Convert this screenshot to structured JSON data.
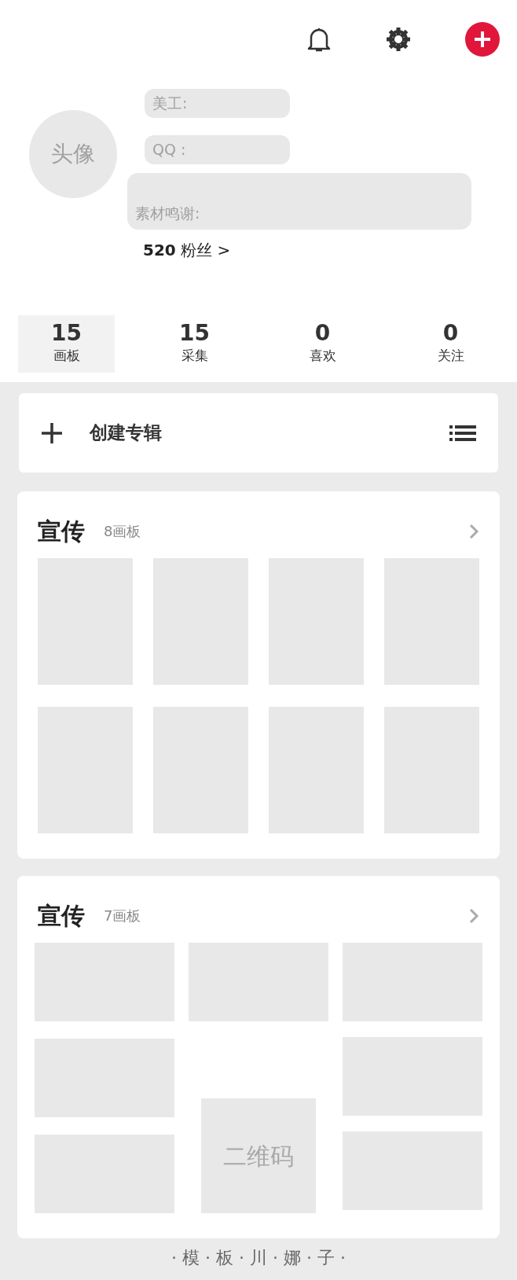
{
  "profile": {
    "avatar_label": "头像",
    "fields": [
      {
        "label": "美工:"
      },
      {
        "label": "QQ :"
      }
    ],
    "credits_label": "素材鸣谢:",
    "followers": {
      "count": "520",
      "label": "粉丝 >"
    }
  },
  "stats": [
    {
      "value": "15",
      "label": "画板",
      "selected": true
    },
    {
      "value": "15",
      "label": "采集",
      "selected": false
    },
    {
      "value": "0",
      "label": "喜欢",
      "selected": false
    },
    {
      "value": "0",
      "label": "关注",
      "selected": false
    }
  ],
  "create_album": {
    "label": "创建专辑"
  },
  "albums": [
    {
      "title": "宣传",
      "count": "8画板",
      "kind": "grid"
    },
    {
      "title": "宣传",
      "count": "7画板",
      "kind": "masonry",
      "qr_label": "二维码"
    }
  ],
  "footer": "· 模 · 板 · 川 · 娜 · 子 ·"
}
